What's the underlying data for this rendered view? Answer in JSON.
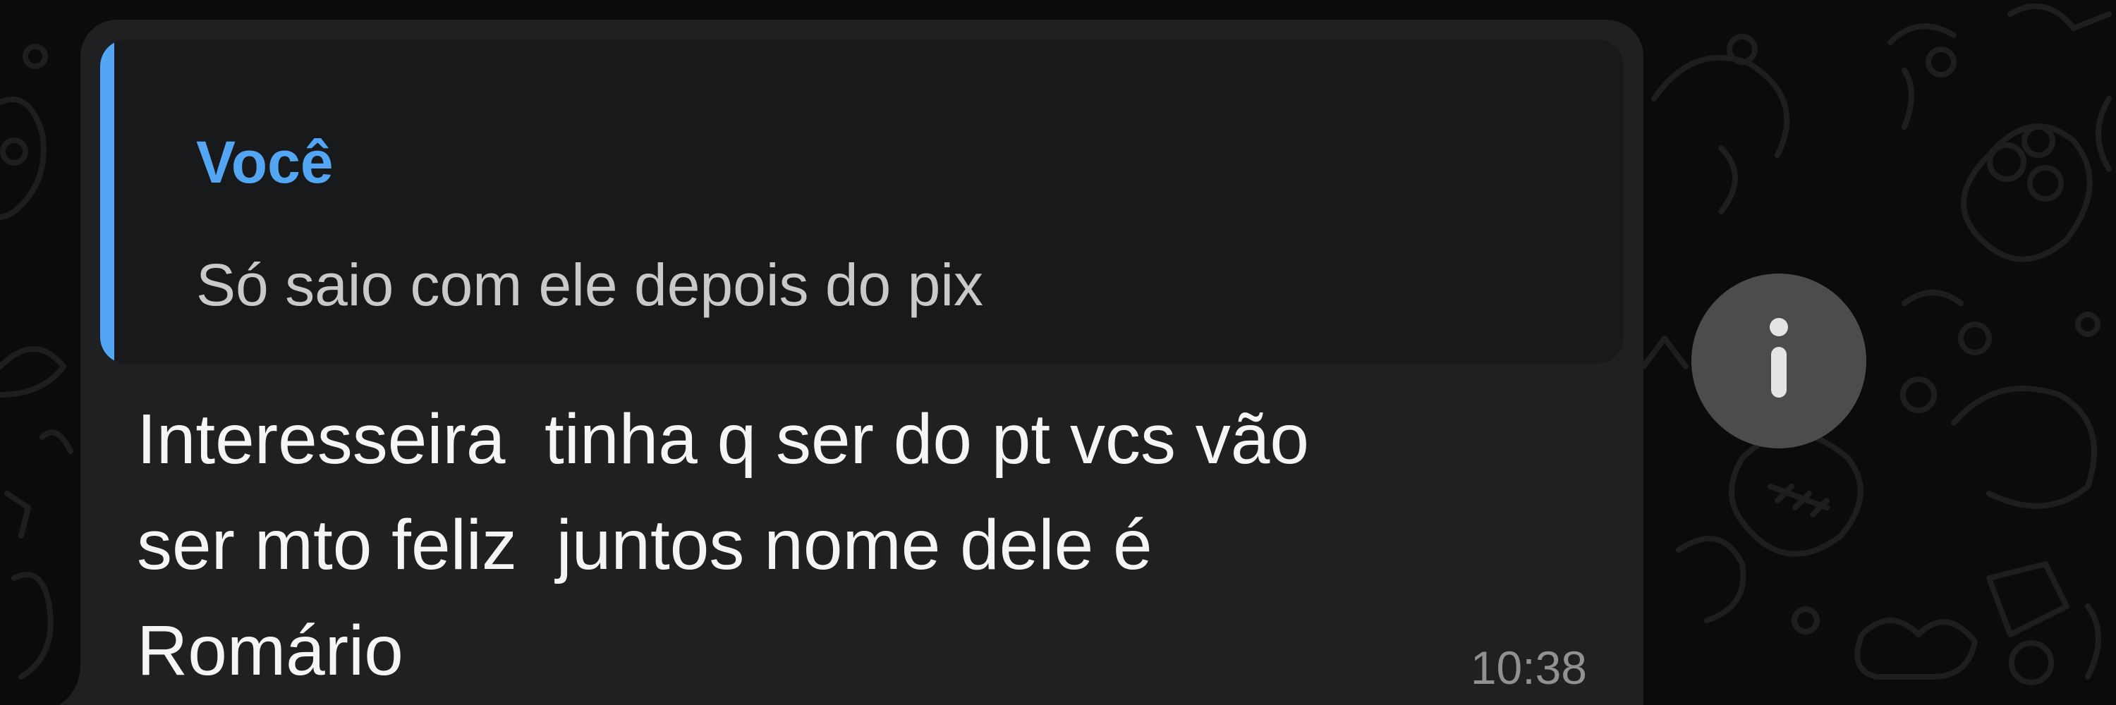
{
  "chat": {
    "reply_quote": {
      "author": "Você",
      "text": "Só saio com ele depois do pix"
    },
    "message": {
      "text": "Interesseira  tinha q ser do pt vcs vão\nser mto feliz  juntos nome dele é\nRomário",
      "time": "10:38"
    },
    "info_icon": "info-icon"
  },
  "colors": {
    "background": "#0b0b0c",
    "bubble": "#1f2021",
    "quote_background": "#18191a",
    "quote_accent": "#53a6f4",
    "message_text": "#f5f5f5",
    "timestamp": "#8f9192",
    "info_button": "#4b4c4e"
  }
}
